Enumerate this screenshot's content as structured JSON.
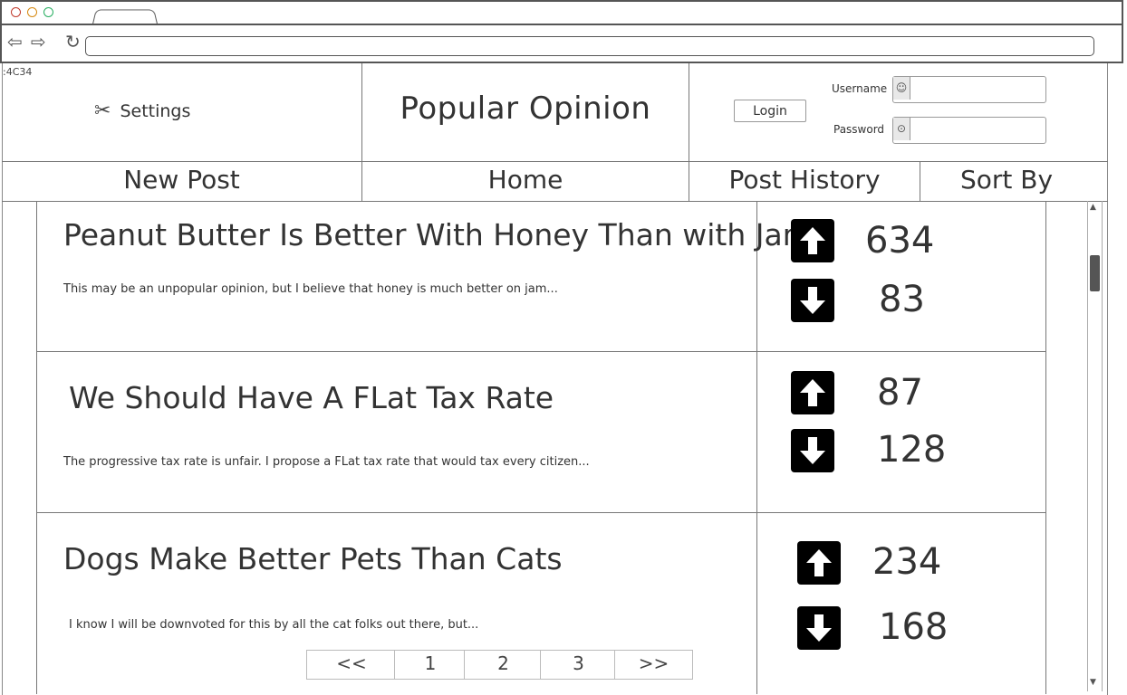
{
  "page_label": ":4C34",
  "header": {
    "settings_label": "Settings",
    "app_title": "Popular Opinion",
    "login_label": "Login",
    "username_label": "Username",
    "password_label": "Password",
    "username_value": "",
    "password_value": ""
  },
  "nav": {
    "new_post": "New Post",
    "home": "Home",
    "post_history": "Post History",
    "sort_by": "Sort By"
  },
  "posts": [
    {
      "title": "Peanut Butter Is Better With Honey Than with Jam",
      "excerpt": "This may be an unpopular opinion, but I believe that honey is much better on jam...",
      "upvotes": "634",
      "downvotes": "83"
    },
    {
      "title": "We Should Have A FLat Tax Rate",
      "excerpt": "The progressive tax rate is unfair. I propose a FLat tax rate that would tax every citizen...",
      "upvotes": "87",
      "downvotes": "128"
    },
    {
      "title": "Dogs Make Better Pets Than Cats",
      "excerpt": "I know I will be downvoted for this by all the cat folks out there, but...",
      "upvotes": "234",
      "downvotes": "168"
    }
  ],
  "pagination": {
    "first": "<<",
    "pages": [
      "1",
      "2",
      "3"
    ],
    "last": ">>"
  },
  "icons": {
    "settings": "tools-icon",
    "username": "user-icon",
    "password": "lock-icon",
    "upvote": "arrow-up-icon",
    "downvote": "arrow-down-icon"
  }
}
